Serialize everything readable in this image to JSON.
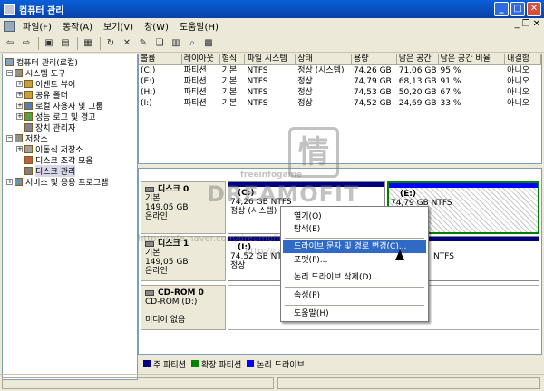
{
  "window": {
    "title": "컴퓨터 관리"
  },
  "menu": [
    "파일(F)",
    "동작(A)",
    "보기(V)",
    "창(W)",
    "도움말(H)"
  ],
  "tree": {
    "root": "컴퓨터 관리(로컬)",
    "system_tools": "시스템 도구",
    "event_viewer": "이벤트 뷰어",
    "shared_folders": "공유 폴더",
    "local_users": "로컬 사용자 및 그룹",
    "perf_logs": "성능 로그 및 경고",
    "device_manager": "장치 관리자",
    "storage": "저장소",
    "removable": "이동식 저장소",
    "defrag": "디스크 조각 모음",
    "disk_mgmt": "디스크 관리",
    "services": "서비스 및 응용 프로그램"
  },
  "volumes": {
    "headers": [
      "볼륨",
      "레이아웃",
      "형식",
      "파일 시스템",
      "상태",
      "용량",
      "남은 공간",
      "남은 공간 비율",
      "내결함"
    ],
    "rows": [
      [
        "(C:)",
        "파티션",
        "기본",
        "NTFS",
        "정상 (시스템)",
        "74,26 GB",
        "71,06 GB",
        "95 %",
        "아니오"
      ],
      [
        "(E:)",
        "파티션",
        "기본",
        "NTFS",
        "정상",
        "74,79 GB",
        "68,13 GB",
        "91 %",
        "아니오"
      ],
      [
        "(H:)",
        "파티션",
        "기본",
        "NTFS",
        "정상",
        "74,53 GB",
        "50,20 GB",
        "67 %",
        "아니오"
      ],
      [
        "(I:)",
        "파티션",
        "기본",
        "NTFS",
        "정상",
        "74,52 GB",
        "24,69 GB",
        "33 %",
        "아니오"
      ]
    ]
  },
  "disks": {
    "disk0": {
      "name": "디스크 0",
      "type": "기본",
      "size": "149,05 GB",
      "status": "온라인",
      "p1_name": "(C:)",
      "p1_info": "74,26 GB NTFS",
      "p1_status": "정상 (시스템)",
      "p2_name": "(E:)",
      "p2_info": "74,79 GB NTFS"
    },
    "disk1": {
      "name": "디스크 1",
      "type": "기본",
      "size": "149,05 GB",
      "status": "온라인",
      "p1_name": "(I:)",
      "p1_info": "74,52 GB NTFS",
      "p1_status": "정상",
      "p2_info": "NTFS"
    },
    "cdrom": {
      "name": "CD-ROM 0",
      "type": "CD-ROM (D:)",
      "status": "미디어 없음"
    }
  },
  "legend": [
    "주 파티션",
    "확장 파티션",
    "논리 드라이브"
  ],
  "context_menu": [
    "열기(O)",
    "탐색(E)",
    "드라이브 문자 및 경로 변경(C)...",
    "포맷(F)...",
    "논리 드라이브 삭제(D)...",
    "속성(P)",
    "도움말(H)"
  ],
  "watermark": {
    "logo": "DREAMOFIT",
    "url1": "http://cafe.naver.com/dreamofit.cafe",
    "url2": "http://cafe.naver.com/dreamofit",
    "small": "freeinfogame",
    "stamp": "情"
  },
  "colors": {
    "primary": "#000080",
    "extended": "#008000",
    "logical": "#0000ff",
    "highlight": "#316ac5"
  }
}
